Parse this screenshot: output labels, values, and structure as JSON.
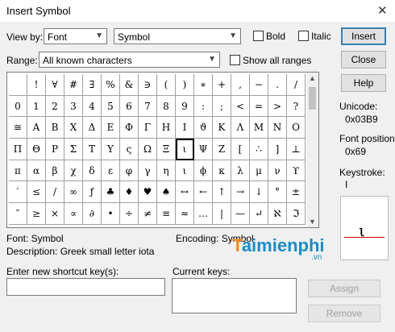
{
  "window": {
    "title": "Insert Symbol",
    "close_glyph": "✕"
  },
  "view_by": {
    "label": "View by:",
    "value": "Font",
    "font_value": "Symbol"
  },
  "bold_label": "Bold",
  "italic_label": "Italic",
  "range": {
    "label": "Range:",
    "value": "All known characters",
    "show_all_label": "Show all ranges"
  },
  "buttons": {
    "insert": "Insert",
    "close": "Close",
    "help": "Help",
    "assign": "Assign",
    "remove": "Remove"
  },
  "info": {
    "unicode_label": "Unicode:",
    "unicode_value": "0x03B9",
    "font_position_label": "Font position:",
    "font_position_value": "0x69",
    "keystroke_label": "Keystroke:",
    "keystroke_value": "I"
  },
  "details": {
    "font": "Font: Symbol",
    "encoding": "Encoding:  Symbol",
    "description": "Description: Greek small letter iota"
  },
  "shortcut": {
    "new_label": "Enter new shortcut key(s):",
    "new_value": "",
    "current_label": "Current keys:"
  },
  "watermark": {
    "brand": "aimienphi",
    "lead": "T",
    "tld": ".vn"
  },
  "grid": {
    "selected_row": 3,
    "selected_col": 9,
    "rows": [
      [
        " ",
        "!",
        "∀",
        "#",
        "∃",
        "%",
        "&",
        "∋",
        "(",
        ")",
        "∗",
        "+",
        ",",
        "−",
        ".",
        "/"
      ],
      [
        "0",
        "1",
        "2",
        "3",
        "4",
        "5",
        "6",
        "7",
        "8",
        "9",
        ":",
        ";",
        "<",
        "=",
        ">",
        "?"
      ],
      [
        "≅",
        "Α",
        "Β",
        "Χ",
        "Δ",
        "Ε",
        "Φ",
        "Γ",
        "Η",
        "Ι",
        "ϑ",
        "Κ",
        "Λ",
        "Μ",
        "Ν",
        "Ο"
      ],
      [
        "Π",
        "Θ",
        "Ρ",
        "Σ",
        "Τ",
        "Υ",
        "ς",
        "Ω",
        "Ξ",
        "ι",
        "Ψ",
        "Ζ",
        "[",
        "∴",
        "]",
        "⊥"
      ],
      [
        "π",
        "α",
        "β",
        "χ",
        "δ",
        "ε",
        "φ",
        "γ",
        "η",
        "ι",
        "ϕ",
        "κ",
        "λ",
        "μ",
        "ν",
        "ϒ"
      ],
      [
        "′",
        "≤",
        "/",
        "∞",
        "ƒ",
        "♣",
        "♦",
        "♥",
        "♠",
        "↔",
        "←",
        "↑",
        "→",
        "↓",
        "°",
        "±"
      ],
      [
        "″",
        "≥",
        "×",
        "∝",
        "∂",
        "•",
        "÷",
        "≠",
        "≡",
        "≈",
        "…",
        "|",
        "—",
        "↵",
        "ℵ",
        "ℑ"
      ]
    ]
  }
}
